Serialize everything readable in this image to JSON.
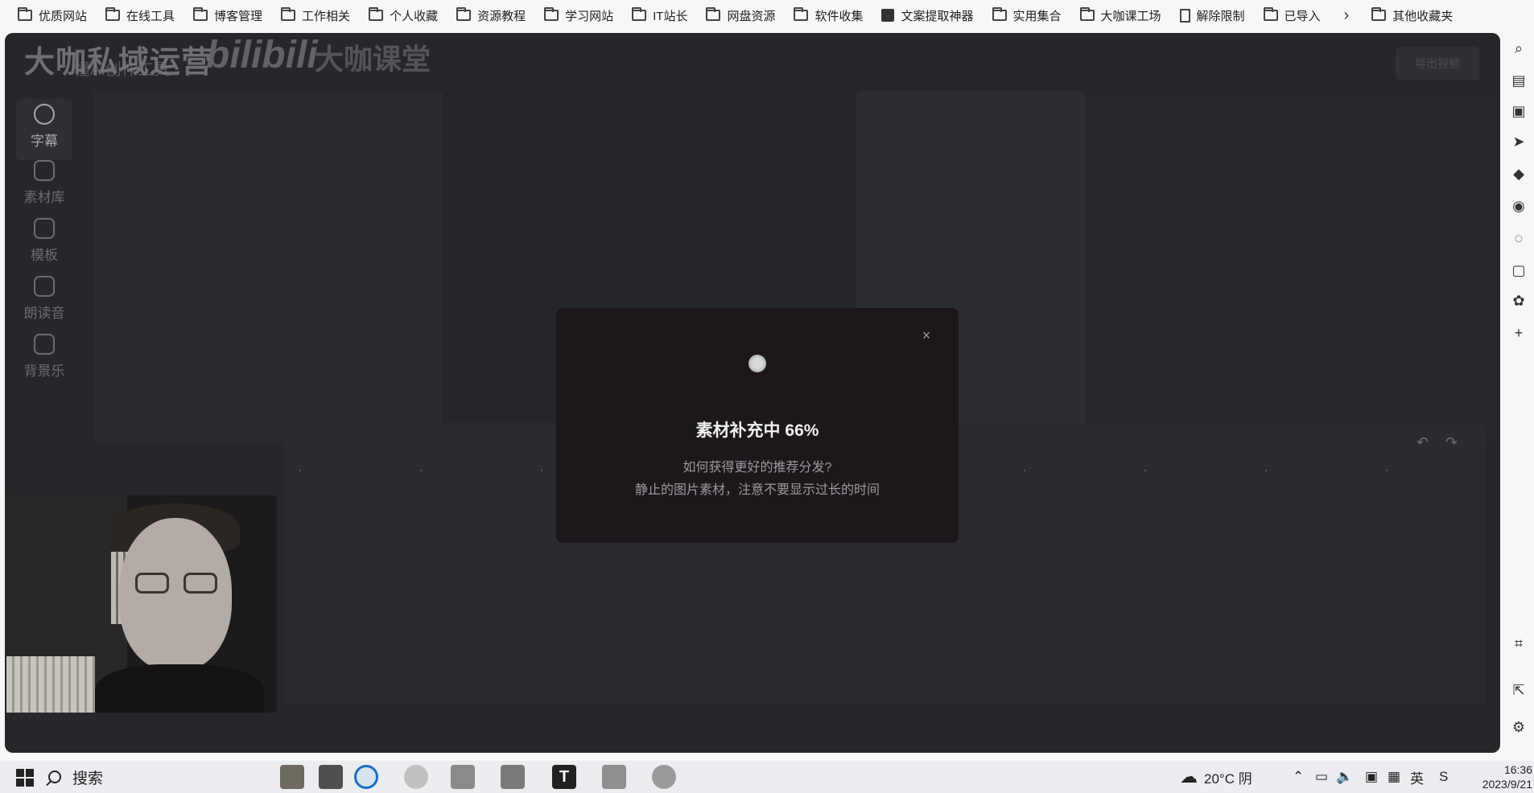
{
  "bookmarks": [
    {
      "label": "优质网站",
      "icon": "folder-icon"
    },
    {
      "label": "在线工具",
      "icon": "folder-icon"
    },
    {
      "label": "博客管理",
      "icon": "folder-icon"
    },
    {
      "label": "工作相关",
      "icon": "folder-icon"
    },
    {
      "label": "个人收藏",
      "icon": "folder-icon"
    },
    {
      "label": "资源教程",
      "icon": "folder-icon"
    },
    {
      "label": "学习网站",
      "icon": "folder-icon"
    },
    {
      "label": "IT站长",
      "icon": "folder-icon"
    },
    {
      "label": "网盘资源",
      "icon": "folder-icon"
    },
    {
      "label": "软件收集",
      "icon": "folder-icon"
    },
    {
      "label": "文案提取神器",
      "icon": "image-icon"
    },
    {
      "label": "实用集合",
      "icon": "folder-icon"
    },
    {
      "label": "大咖课工场",
      "icon": "folder-icon"
    },
    {
      "label": "解除限制",
      "icon": "document-icon"
    },
    {
      "label": "已导入",
      "icon": "folder-icon"
    }
  ],
  "bookmarks_more": "›",
  "bookmarks_other": "其他收藏夹",
  "watermark": {
    "left": "大咖私域运营",
    "bili": "bilibili",
    "right": "大咖课堂"
  },
  "app": {
    "title": "懂AI创作工具",
    "top_right_button": "导出视频",
    "nav": [
      {
        "label": "字幕",
        "icon": "subtitle-icon",
        "active": true
      },
      {
        "label": "素材库",
        "icon": "layers-icon",
        "active": false
      },
      {
        "label": "模板",
        "icon": "template-icon",
        "active": false
      },
      {
        "label": "朗读音",
        "icon": "voice-icon",
        "active": false
      },
      {
        "label": "背景乐",
        "icon": "music-icon",
        "active": false
      }
    ]
  },
  "modal": {
    "close": "×",
    "title": "素材补充中 66%",
    "progress_percent": 66,
    "subtitle_line1": "如何获得更好的推荐分发?",
    "subtitle_line2": "静止的图片素材，注意不要显示过长的时间"
  },
  "timeline": {
    "prev": "⏮",
    "play": "▶",
    "next": "⏭",
    "undo": "↶",
    "redo": "↷"
  },
  "taskbar": {
    "search_label": "搜索",
    "weather": "20°C 阴",
    "ime": "英",
    "time": "16:36",
    "date": "2023/9/21"
  }
}
